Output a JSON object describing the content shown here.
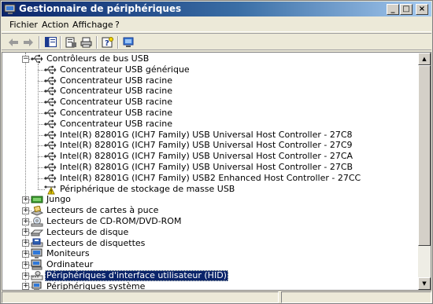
{
  "window": {
    "title": "Gestionnaire de périphériques",
    "controls": {
      "minimize": "_",
      "maximize": "□",
      "close": "×"
    }
  },
  "menubar": {
    "items": [
      "Fichier",
      "Action",
      "Affichage",
      "?"
    ]
  },
  "toolbar": {
    "buttons": [
      "back-icon",
      "forward-icon",
      "show-hide-console-tree-icon",
      "properties-icon",
      "print-icon",
      "help-icon",
      "scan-hardware-icon"
    ]
  },
  "tree": {
    "usb_category": "Contrôleurs de bus USB",
    "usb_children": [
      "Concentrateur USB générique",
      "Concentrateur USB racine",
      "Concentrateur USB racine",
      "Concentrateur USB racine",
      "Concentrateur USB racine",
      "Concentrateur USB racine",
      "Intel(R) 82801G (ICH7 Family) USB Universal Host Controller - 27C8",
      "Intel(R) 82801G (ICH7 Family) USB Universal Host Controller - 27C9",
      "Intel(R) 82801G (ICH7 Family) USB Universal Host Controller - 27CA",
      "Intel(R) 82801G (ICH7 Family) USB Universal Host Controller - 27CB",
      "Intel(R) 82801G (ICH7 Family) USB2 Enhanced Host Controller - 27CC",
      "Périphérique de stockage de masse USB"
    ],
    "categories": [
      "Jungo",
      "Lecteurs de cartes à puce",
      "Lecteurs de CD-ROM/DVD-ROM",
      "Lecteurs de disque",
      "Lecteurs de disquettes",
      "Moniteurs",
      "Ordinateur",
      "Périphériques d'interface utilisateur (HID)",
      "Périphériques système"
    ],
    "selected": "Périphériques d'interface utilisateur (HID)"
  },
  "colors": {
    "title_start": "#0a246a",
    "selection": "#0a246a",
    "warning": "#f5d800"
  }
}
